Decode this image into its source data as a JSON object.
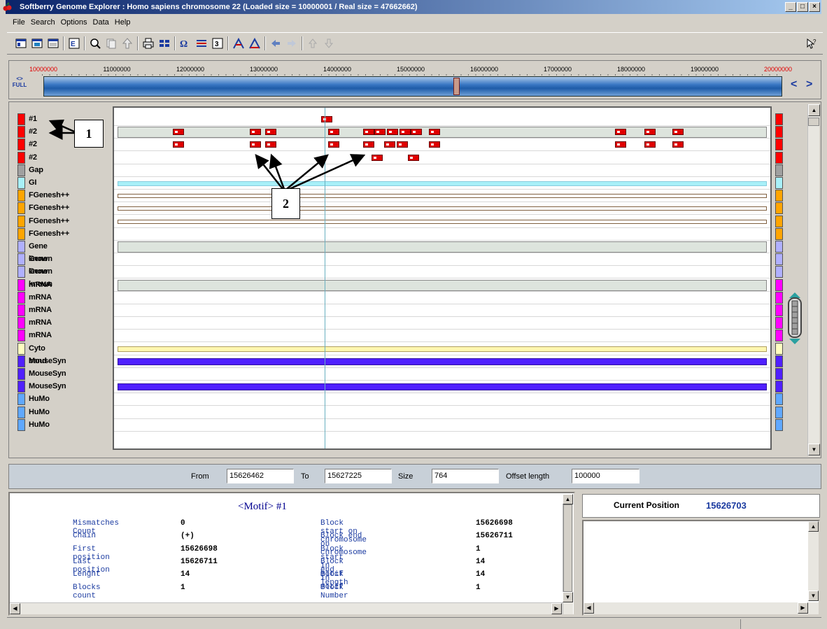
{
  "window": {
    "title": "Softberry Genome Explorer : Homo sapiens chromosome 22 (Loaded size = 10000001 / Real size = 47662662)",
    "controls": [
      "_",
      "□",
      "×"
    ]
  },
  "menu": [
    "File",
    "Search",
    "Options",
    "Data",
    "Help"
  ],
  "toolbar": {
    "icons": [
      "open-icon",
      "save-icon",
      "window-icon",
      "export-icon",
      "zoom-icon",
      "copy-icon",
      "up-icon",
      "print-icon",
      "settings-icon",
      "find-motif-icon",
      "list-icon",
      "number-icon",
      "align-icon",
      "align2-icon",
      "back-icon",
      "forward-icon",
      "up-arrow-icon",
      "down-arrow-icon",
      "help-icon"
    ]
  },
  "ruler": {
    "ticks": [
      "10000000",
      "11000000",
      "12000000",
      "13000000",
      "14000000",
      "15000000",
      "16000000",
      "17000000",
      "18000000",
      "19000000",
      "20000000"
    ],
    "full_label_top": "<>",
    "full_label_bottom": "FULL",
    "left_arrow": "<",
    "right_arrow": ">"
  },
  "tracks": [
    {
      "label": "#1",
      "color": "#ff0000"
    },
    {
      "label": "#2",
      "color": "#ff0000"
    },
    {
      "label": "#2",
      "color": "#ff0000"
    },
    {
      "label": "#2",
      "color": "#ff0000"
    },
    {
      "label": "Gap",
      "color": "#a0a0a0"
    },
    {
      "label": "GI",
      "color": "#a8f0f8"
    },
    {
      "label": "FGenesh++",
      "color": "#ffa500"
    },
    {
      "label": "FGenesh++",
      "color": "#ffa500"
    },
    {
      "label": "FGenesh++",
      "color": "#ffa500"
    },
    {
      "label": "FGenesh++",
      "color": "#ffa500"
    },
    {
      "label": "Gene known",
      "color": "#b0b0ff"
    },
    {
      "label": "Gene known",
      "color": "#b0b0ff"
    },
    {
      "label": "Gene known",
      "color": "#b0b0ff"
    },
    {
      "label": "mRNA",
      "color": "#ff00ff"
    },
    {
      "label": "mRNA",
      "color": "#ff00ff"
    },
    {
      "label": "mRNA",
      "color": "#ff00ff"
    },
    {
      "label": "mRNA",
      "color": "#ff00ff"
    },
    {
      "label": "mRNA",
      "color": "#ff00ff"
    },
    {
      "label": "Cyto band",
      "color": "#ffffc0"
    },
    {
      "label": "MouseSyn",
      "color": "#5020ff"
    },
    {
      "label": "MouseSyn",
      "color": "#5020ff"
    },
    {
      "label": "MouseSyn",
      "color": "#5020ff"
    },
    {
      "label": "HuMo",
      "color": "#60a8ff"
    },
    {
      "label": "HuMo",
      "color": "#60a8ff"
    },
    {
      "label": "HuMo",
      "color": "#60a8ff"
    }
  ],
  "callouts": {
    "one": "1",
    "two": "2"
  },
  "range": {
    "from_label": "From",
    "from_value": "15626462",
    "to_label": "To",
    "to_value": "15627225",
    "size_label": "Size",
    "size_value": "764",
    "offset_label": "Offset length",
    "offset_value": "100000"
  },
  "info": {
    "title": "<Motif> #1",
    "left": [
      {
        "label": "Mismatches  Count",
        "value": "0"
      },
      {
        "label": "Chain",
        "value": "(+)"
      },
      {
        "label": "First position",
        "value": "15626698"
      },
      {
        "label": "Last position",
        "value": "15626711"
      },
      {
        "label": "Lenght",
        "value": "14"
      },
      {
        "label": "Blocks count",
        "value": "1"
      }
    ],
    "right": [
      {
        "label": "Block start on chromosome",
        "value": "15626698"
      },
      {
        "label": "Block end on chromosome",
        "value": "15626711"
      },
      {
        "label": "Block start in motif",
        "value": "1"
      },
      {
        "label": "Block end in motif",
        "value": "14"
      },
      {
        "label": "Block length",
        "value": "14"
      },
      {
        "label": "Block Number",
        "value": "1"
      }
    ]
  },
  "position": {
    "label": "Current Position",
    "value": "15626703"
  }
}
